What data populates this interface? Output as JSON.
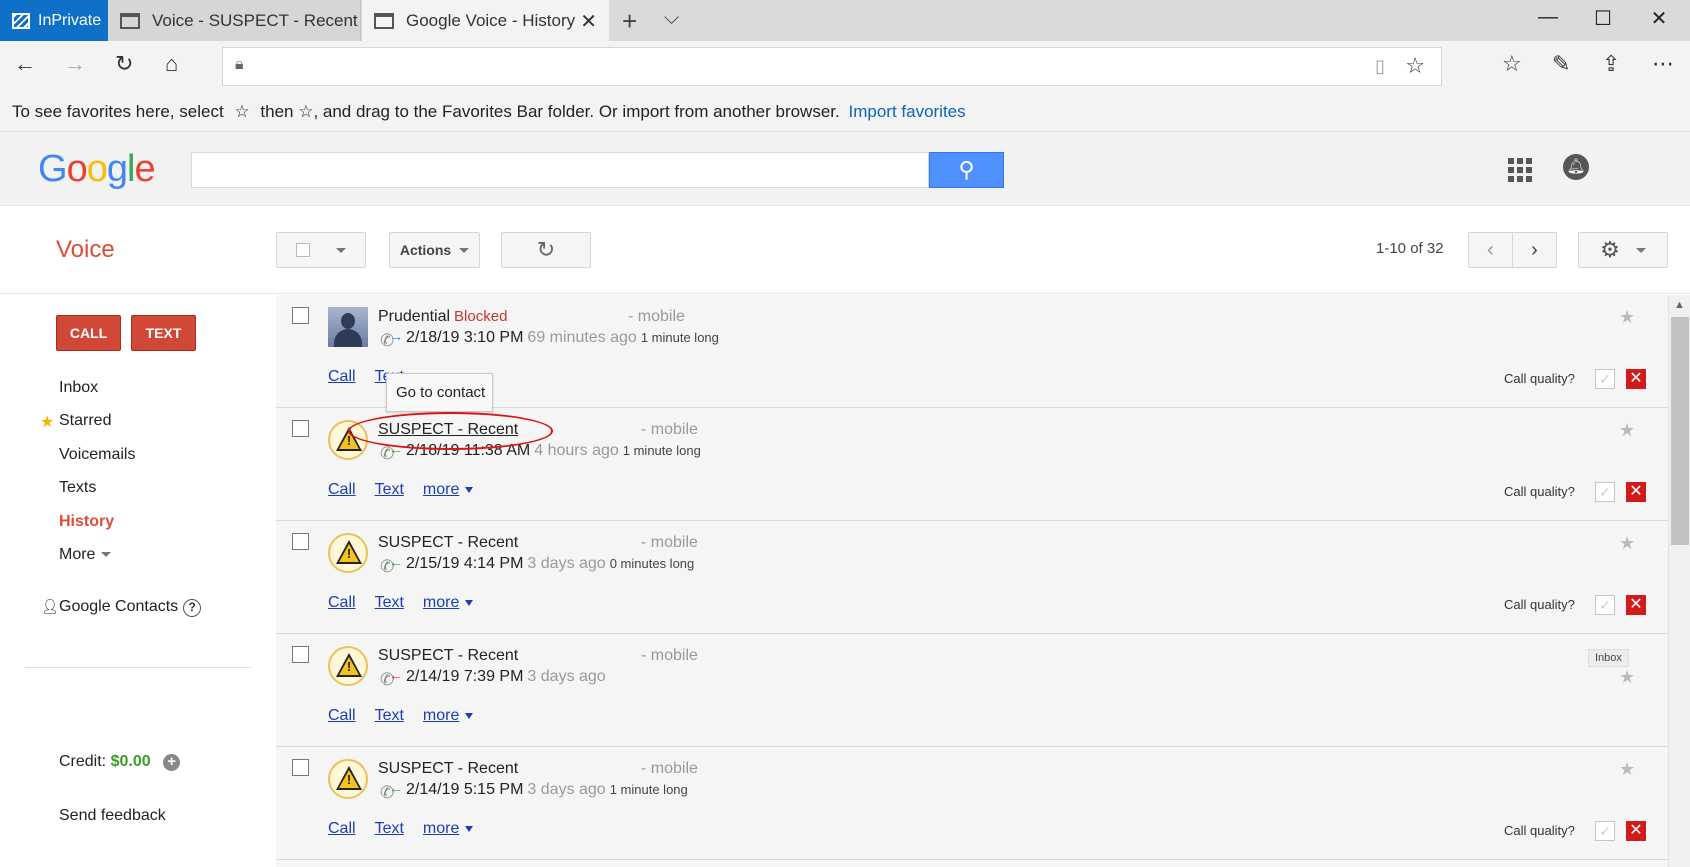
{
  "browser": {
    "inprivate_label": "InPrivate",
    "tabs": [
      {
        "title": "Voice - SUSPECT - Recent"
      },
      {
        "title": "Google Voice - History"
      }
    ],
    "new_tab_glyph": "+",
    "favbar_text_pre": "To see favorites here, select",
    "favbar_text_mid": "then ☆, and drag to the Favorites Bar folder. Or import from another browser.",
    "favbar_link": "Import favorites"
  },
  "google": {
    "logo_letters": [
      "G",
      "o",
      "o",
      "g",
      "l",
      "e"
    ],
    "logo_colors": [
      "#4285f4",
      "#ea4335",
      "#fbbc05",
      "#4285f4",
      "#34a853",
      "#ea4335"
    ]
  },
  "toolbar": {
    "title": "Voice",
    "actions_label": "Actions",
    "pager": "1-10 of 32"
  },
  "sidebar": {
    "call_label": "CALL",
    "text_label": "TEXT",
    "items": [
      {
        "label": "Inbox"
      },
      {
        "label": "Starred"
      },
      {
        "label": "Voicemails"
      },
      {
        "label": "Texts"
      },
      {
        "label": "History"
      },
      {
        "label": "More"
      }
    ],
    "contacts_label": "Google Contacts",
    "help_glyph": "?",
    "credit_label": "Credit:",
    "credit_value": "$0.00",
    "feedback_label": "Send feedback"
  },
  "tooltip": "Go to contact",
  "rows": [
    {
      "name": "Prudential",
      "status": "Blocked",
      "type": "- mobile",
      "date": "2/18/19 3:10 PM",
      "ago": "69 minutes ago",
      "duration": "1 minute long",
      "call": "Call",
      "text": "Text",
      "more": "",
      "quality": "Call quality?"
    },
    {
      "name": "SUSPECT - Recent",
      "status": "",
      "type": "- mobile",
      "date": "2/18/19 11:38 AM",
      "ago": "4 hours ago",
      "duration": "1 minute long",
      "call": "Call",
      "text": "Text",
      "more": "more",
      "quality": "Call quality?"
    },
    {
      "name": "SUSPECT - Recent",
      "status": "",
      "type": "- mobile",
      "date": "2/15/19 4:14 PM",
      "ago": "3 days ago",
      "duration": "0 minutes long",
      "call": "Call",
      "text": "Text",
      "more": "more",
      "quality": "Call quality?"
    },
    {
      "name": "SUSPECT - Recent",
      "status": "",
      "type": "- mobile",
      "date": "2/14/19 7:39 PM",
      "ago": "3 days ago",
      "duration": "",
      "call": "Call",
      "text": "Text",
      "more": "more",
      "quality": "",
      "badge": "Inbox"
    },
    {
      "name": "SUSPECT - Recent",
      "status": "",
      "type": "- mobile",
      "date": "2/14/19 5:15 PM",
      "ago": "3 days ago",
      "duration": "1 minute long",
      "call": "Call",
      "text": "Text",
      "more": "more",
      "quality": "Call quality?"
    }
  ],
  "colors": {
    "accent_red": "#dd4b39",
    "link_blue": "#1a3fb4",
    "credit_green": "#3c9d22"
  }
}
